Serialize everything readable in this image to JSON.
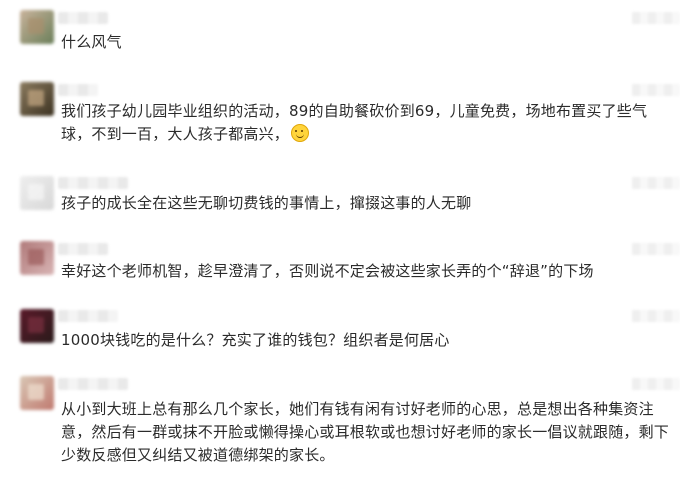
{
  "comments": [
    {
      "text": "什么风气"
    },
    {
      "text": "我们孩子幼儿园毕业组织的活动，89的自助餐砍价到69，儿童免费，场地布置买了些气球，不到一百，大人孩子都高兴，",
      "emoji": "smile-emoji"
    },
    {
      "text": "孩子的成长全在这些无聊切费钱的事情上，撺掇这事的人无聊"
    },
    {
      "text": "幸好这个老师机智，趁早澄清了，否则说不定会被这些家长弄的个“辞退”的下场"
    },
    {
      "text": "1000块钱吃的是什么？充实了谁的钱包？组织者是何居心"
    },
    {
      "text": "从小到大班上总有那么几个家长，她们有钱有闲有讨好老师的心思，总是想出各种集资注意，然后有一群或抹不开脸或懒得操心或耳根软或也想讨好老师的家长一倡议就跟随，剩下少数反感但又纠结又被道德绑架的家长。"
    }
  ],
  "colors": {
    "text": "#2b2b2b",
    "background": "#ffffff"
  }
}
